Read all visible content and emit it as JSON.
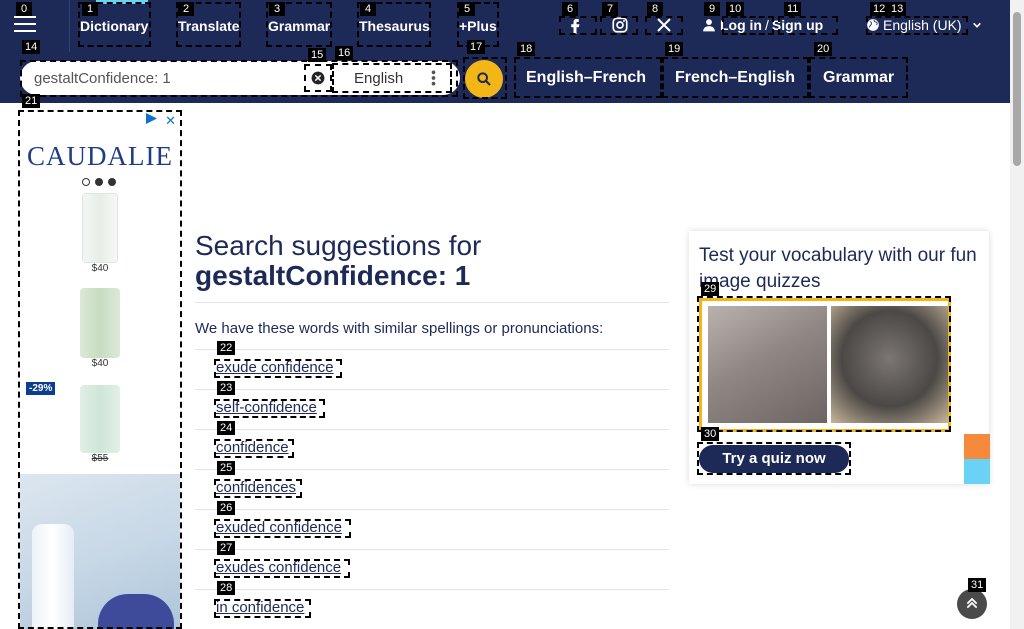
{
  "nav": {
    "items": [
      "Dictionary",
      "Translate",
      "Grammar",
      "Thesaurus",
      "+Plus"
    ],
    "login": "Log in",
    "login_sep": "/",
    "signup": "Sign up",
    "language": "English (UK)"
  },
  "search": {
    "value": "gestaltConfidence: 1",
    "dictionary": "English",
    "quick_links": [
      "English–French",
      "French–English",
      "Grammar"
    ]
  },
  "ad": {
    "brand": "CAUDALIE",
    "prices": [
      "$40",
      "$40",
      "$55"
    ],
    "discount": "-29%",
    "close": "✕",
    "colors": {
      "brand": "#1f3c86",
      "discount_bg": "#0b3d91"
    }
  },
  "main": {
    "heading_prefix": "Search suggestions for",
    "heading_term": "gestaltConfidence: 1",
    "intro": "We have these words with similar spellings or pronunciations:",
    "suggestions": [
      "exude confidence",
      "self-confidence",
      "confidence",
      "confidences",
      "exuded confidence",
      "exudes confidence",
      "in confidence"
    ]
  },
  "quiz": {
    "title": "Test your vocabulary with our fun image quizzes",
    "button": "Try a quiz now"
  },
  "badges": [
    "0",
    "1",
    "2",
    "3",
    "4",
    "5",
    "6",
    "7",
    "8",
    "9",
    "10",
    "11",
    "12",
    "13",
    "14",
    "15",
    "16",
    "17",
    "18",
    "19",
    "20",
    "21",
    "22",
    "23",
    "24",
    "25",
    "26",
    "27",
    "28",
    "29",
    "30",
    "31"
  ],
  "colors": {
    "brand_navy": "#1d2a57",
    "search_accent": "#f3b617",
    "page_bg": "#ffffff"
  },
  "icons": [
    "menu-icon",
    "facebook-icon",
    "instagram-icon",
    "x-icon",
    "user-icon",
    "globe-icon",
    "chevron-down-icon",
    "clear-icon",
    "kebab-icon",
    "search-icon",
    "close-icon",
    "arrow-up-icon"
  ]
}
